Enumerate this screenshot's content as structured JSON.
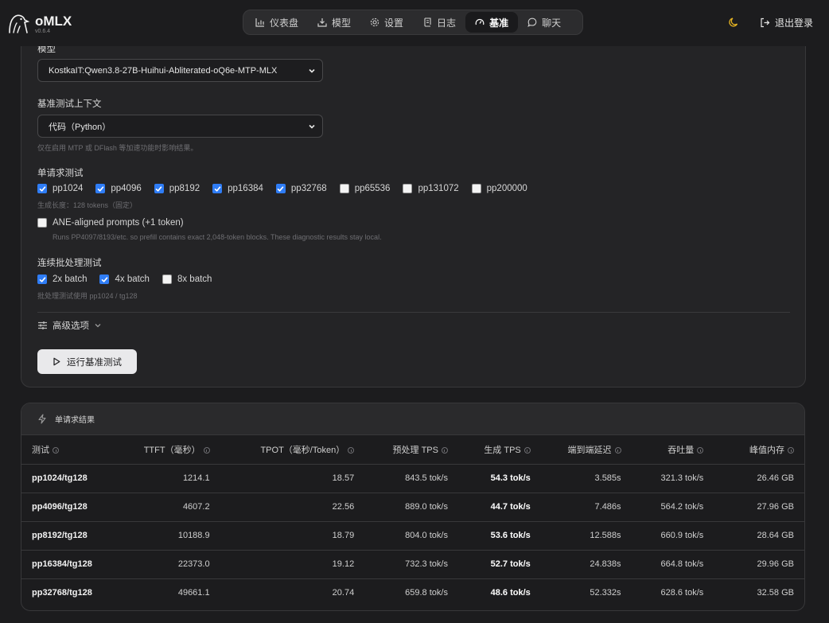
{
  "app": {
    "name": "oMLX",
    "version": "v0.6.4"
  },
  "nav": {
    "items": [
      {
        "label": "仪表盘",
        "icon": "bar-chart-icon"
      },
      {
        "label": "模型",
        "icon": "download-box-icon"
      },
      {
        "label": "设置",
        "icon": "gear-icon"
      },
      {
        "label": "日志",
        "icon": "scroll-icon"
      },
      {
        "label": "基准",
        "icon": "gauge-icon",
        "active": true
      },
      {
        "label": "聊天",
        "icon": "chat-bubble-icon"
      }
    ]
  },
  "header": {
    "logout_label": "退出登录",
    "theme_icon": "moon-icon",
    "theme_color": "#e6b422"
  },
  "config": {
    "model_label": "模型",
    "model_value": "KostkaIT:Qwen3.8-27B-Huihui-Abliterated-oQ6e-MTP-MLX",
    "context_label": "基准测试上下文",
    "context_value": "代码（Python）",
    "context_hint": "仅在启用 MTP 或 DFlash 等加速功能时影响结果。",
    "single_label": "单请求测试",
    "single_options": [
      {
        "label": "pp1024",
        "checked": true
      },
      {
        "label": "pp4096",
        "checked": true
      },
      {
        "label": "pp8192",
        "checked": true
      },
      {
        "label": "pp16384",
        "checked": true
      },
      {
        "label": "pp32768",
        "checked": true
      },
      {
        "label": "pp65536",
        "checked": false
      },
      {
        "label": "pp131072",
        "checked": false
      },
      {
        "label": "pp200000",
        "checked": false
      }
    ],
    "single_hint": "生成长度：128 tokens（固定）",
    "ane_label": "ANE-aligned prompts (+1 token)",
    "ane_checked": false,
    "ane_hint": "Runs PP4097/8193/etc. so prefill contains exact 2,048-token blocks. These diagnostic results stay local.",
    "batch_label": "连续批处理测试",
    "batch_options": [
      {
        "label": "2x batch",
        "checked": true
      },
      {
        "label": "4x batch",
        "checked": true
      },
      {
        "label": "8x batch",
        "checked": false
      }
    ],
    "batch_hint": "批处理测试使用 pp1024 / tg128",
    "advanced_label": "高级选项",
    "run_label": "运行基准测试"
  },
  "results": {
    "title": "单请求结果",
    "columns": [
      "测试",
      "TTFT（毫秒）",
      "TPOT（毫秒/Token）",
      "预处理 TPS",
      "生成 TPS",
      "端到端延迟",
      "吞吐量",
      "峰值内存"
    ],
    "rows": [
      [
        "pp1024/tg128",
        "1214.1",
        "18.57",
        "843.5 tok/s",
        "54.3 tok/s",
        "3.585s",
        "321.3 tok/s",
        "26.46 GB"
      ],
      [
        "pp4096/tg128",
        "4607.2",
        "22.56",
        "889.0 tok/s",
        "44.7 tok/s",
        "7.486s",
        "564.2 tok/s",
        "27.96 GB"
      ],
      [
        "pp8192/tg128",
        "10188.9",
        "18.79",
        "804.0 tok/s",
        "53.6 tok/s",
        "12.588s",
        "660.9 tok/s",
        "28.64 GB"
      ],
      [
        "pp16384/tg128",
        "22373.0",
        "19.12",
        "732.3 tok/s",
        "52.7 tok/s",
        "24.838s",
        "664.8 tok/s",
        "29.96 GB"
      ],
      [
        "pp32768/tg128",
        "49661.1",
        "20.74",
        "659.8 tok/s",
        "48.6 tok/s",
        "52.332s",
        "628.6 tok/s",
        "32.58 GB"
      ]
    ]
  },
  "colors": {
    "accent": "#2f7df6",
    "background": "#1c1c1e",
    "panel": "#242426"
  }
}
